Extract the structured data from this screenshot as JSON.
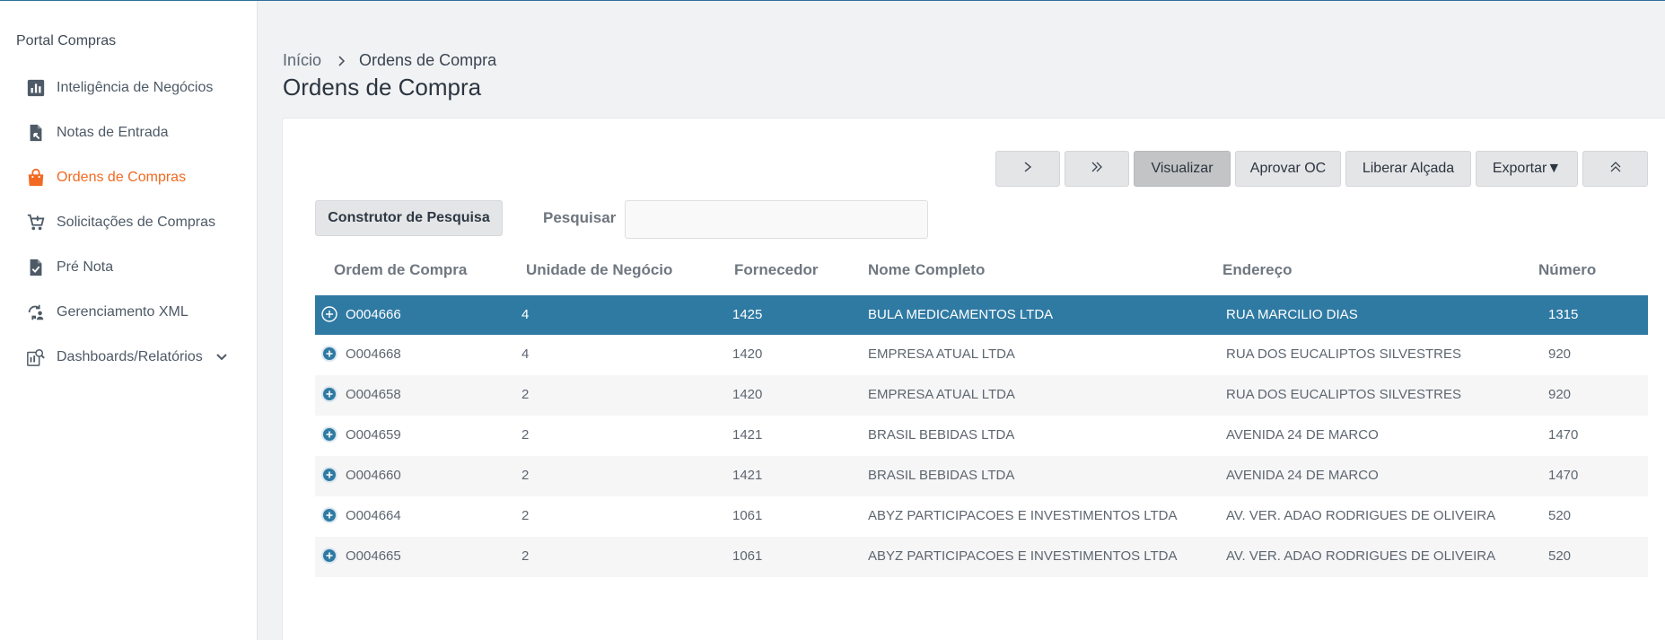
{
  "sidebar": {
    "title": "Portal Compras",
    "items": [
      {
        "label": "Inteligência de Negócios",
        "icon": "bar-chart-icon",
        "active": false
      },
      {
        "label": "Notas de Entrada",
        "icon": "document-arrow-icon",
        "active": false
      },
      {
        "label": "Ordens de Compras",
        "icon": "shopping-bag-icon",
        "active": true
      },
      {
        "label": "Solicitações de Compras",
        "icon": "cart-add-icon",
        "active": false
      },
      {
        "label": "Pré Nota",
        "icon": "document-check-icon",
        "active": false
      },
      {
        "label": "Gerenciamento XML",
        "icon": "sync-person-icon",
        "active": false
      },
      {
        "label": "Dashboards/Relatórios",
        "icon": "dashboard-search-icon",
        "active": false
      }
    ]
  },
  "breadcrumb": {
    "home": "Início",
    "current": "Ordens de Compra"
  },
  "page_title": "Ordens de Compra",
  "toolbar": {
    "next_icon": "chevron-right-icon",
    "last_icon": "double-chevron-right-icon",
    "visualize": "Visualizar",
    "approve": "Aprovar OC",
    "release": "Liberar Alçada",
    "export": "Exportar▼",
    "collapse_icon": "double-chevron-up-icon"
  },
  "search": {
    "builder_label": "Construtor de Pesquisa",
    "label": "Pesquisar",
    "value": ""
  },
  "table": {
    "columns": [
      "Ordem de Compra",
      "Unidade de Negócio",
      "Fornecedor",
      "Nome Completo",
      "Endereço",
      "Número"
    ],
    "rows": [
      {
        "ordem": "O004666",
        "unidade": "4",
        "fornecedor": "1425",
        "nome": "BULA MEDICAMENTOS LTDA",
        "endereco": "RUA MARCILIO DIAS",
        "numero": "1315",
        "selected": true
      },
      {
        "ordem": "O004668",
        "unidade": "4",
        "fornecedor": "1420",
        "nome": "EMPRESA ATUAL LTDA",
        "endereco": "RUA DOS EUCALIPTOS SILVESTRES",
        "numero": "920",
        "selected": false
      },
      {
        "ordem": "O004658",
        "unidade": "2",
        "fornecedor": "1420",
        "nome": "EMPRESA ATUAL LTDA",
        "endereco": "RUA DOS EUCALIPTOS SILVESTRES",
        "numero": "920",
        "selected": false
      },
      {
        "ordem": "O004659",
        "unidade": "2",
        "fornecedor": "1421",
        "nome": "BRASIL BEBIDAS LTDA",
        "endereco": "AVENIDA 24 DE MARCO",
        "numero": "1470",
        "selected": false
      },
      {
        "ordem": "O004660",
        "unidade": "2",
        "fornecedor": "1421",
        "nome": "BRASIL BEBIDAS LTDA",
        "endereco": "AVENIDA 24 DE MARCO",
        "numero": "1470",
        "selected": false
      },
      {
        "ordem": "O004664",
        "unidade": "2",
        "fornecedor": "1061",
        "nome": "ABYZ PARTICIPACOES E INVESTIMENTOS LTDA",
        "endereco": "AV. VER. ADAO RODRIGUES DE OLIVEIRA",
        "numero": "520",
        "selected": false
      },
      {
        "ordem": "O004665",
        "unidade": "2",
        "fornecedor": "1061",
        "nome": "ABYZ PARTICIPACOES E INVESTIMENTOS LTDA",
        "endereco": "AV. VER. ADAO RODRIGUES DE OLIVEIRA",
        "numero": "520",
        "selected": false
      }
    ]
  },
  "colors": {
    "accent": "#f26a21",
    "selected_row": "#2f7aa3",
    "expand_icon": "#2f7aa3"
  }
}
